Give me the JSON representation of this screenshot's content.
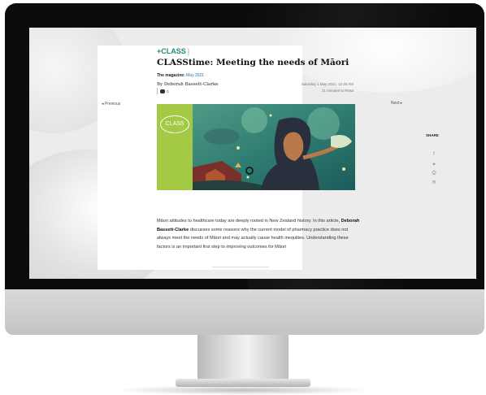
{
  "section": {
    "label": "+CLASS",
    "separator": "|"
  },
  "article": {
    "title": "CLASStime: Meeting the needs of Māori",
    "magazine_label": "The magazine:",
    "magazine_issue": "May 2021",
    "byline": "By Deborah Bassett-Clarke",
    "date": "Saturday 1 May 2021, 12:25 AM",
    "read_time": "21 minutes to Read",
    "comment_count": "0",
    "lede_part1": "Māori attitudes to healthcare today are deeply rooted in New Zealand history. In this article, ",
    "lede_author": "Deborah Bassett-Clarke",
    "lede_part2": " discusses some reasons why the current model of pharmacy practice does not always meet the needs of Māori and may actually cause health inequities. Understanding these factors is an important first step to improving outcomes for Māori"
  },
  "nav": {
    "previous": "◂ Previous",
    "next": "Next ▸"
  },
  "hero": {
    "badge": "CLASS",
    "badge_color": "#a4c944"
  },
  "share": {
    "label": "SHARE",
    "icons": [
      "facebook-icon",
      "twitter-icon",
      "print-icon",
      "email-icon"
    ]
  },
  "colors": {
    "accent": "#1f8a7a",
    "link": "#1a6fb3"
  }
}
